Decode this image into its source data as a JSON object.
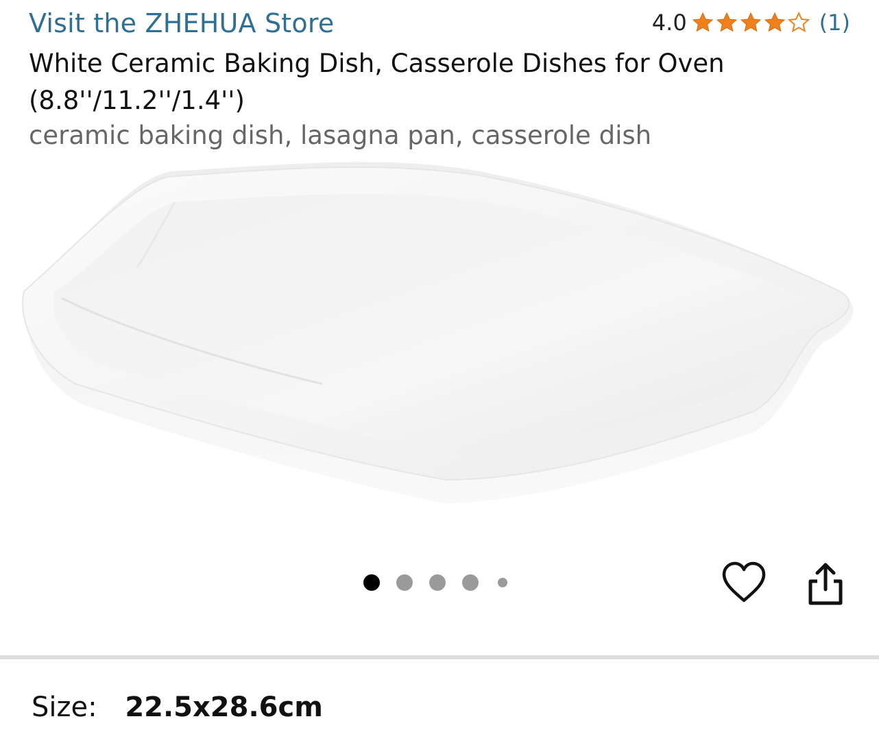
{
  "store": {
    "link_text": "Visit the ZHEHUA Store"
  },
  "rating": {
    "value": "4.0",
    "stars_filled": 4,
    "stars_total": 5,
    "count": "(1)",
    "star_color": "#f0801c"
  },
  "product": {
    "title": "White Ceramic Baking Dish, Casserole Dishes for Oven (8.8''/11.2''/1.4'')",
    "keywords": "ceramic baking dish, lasagna pan, casserole dish"
  },
  "gallery": {
    "image_icon": "white-ceramic-dish-image",
    "image_count": 5,
    "active_index": 0
  },
  "actions": {
    "wishlist_icon": "heart-icon",
    "share_icon": "share-icon"
  },
  "size": {
    "label": "Size:",
    "value": "22.5x28.6cm"
  },
  "colors": {
    "link": "#2f6f94",
    "star": "#f0801c",
    "keywords": "#666666"
  }
}
